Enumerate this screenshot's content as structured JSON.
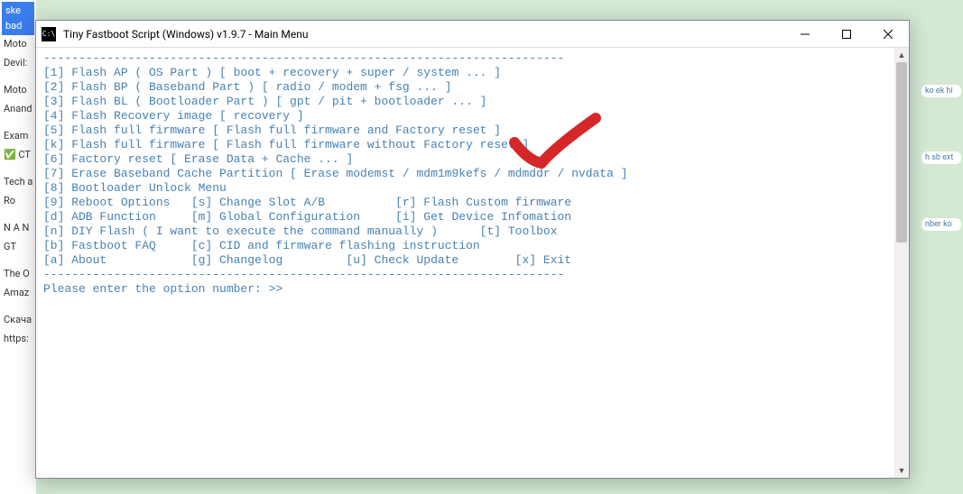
{
  "bg": {
    "blue_banner": "ske bad",
    "left_items": [
      "Moto",
      "Devil:",
      "",
      "Moto",
      "Anand",
      "",
      "Exam",
      "✅ CT",
      "",
      "Tech a",
      "Ro",
      "",
      "N A N",
      "GT",
      "",
      "The O",
      "Amaz",
      "",
      "Скача",
      "https:"
    ],
    "right_items": [
      "ko ek hi",
      "h sb ext",
      "nber ko"
    ]
  },
  "window": {
    "title": "Tiny Fastboot Script (Windows) v1.9.7 - Main Menu",
    "icon_text": "C:\\"
  },
  "console": {
    "lines": [
      "--------------------------------------------------------------------------",
      "[1] Flash AP ( OS Part ) [ boot + recovery + super / system ... ]",
      "[2] Flash BP ( Baseband Part ) [ radio / modem + fsg ... ]",
      "[3] Flash BL ( Bootloader Part ) [ gpt / pit + bootloader ... ]",
      "[4] Flash Recovery image [ recovery ]",
      "[5] Flash full firmware [ Flash full firmware and Factory reset ]",
      "[k] Flash full firmware [ Flash full firmware without Factory reset ]",
      "",
      "[6] Factory reset [ Erase Data + Cache ... ]",
      "[7] Erase Baseband Cache Partition [ Erase modemst / mdm1m9kefs / mdmddr / nvdata ]",
      "",
      "[8] Bootloader Unlock Menu",
      "",
      "[9] Reboot Options   [s] Change Slot A/B          [r] Flash Custom firmware",
      "",
      "[d] ADB Function     [m] Global Configuration     [i] Get Device Infomation",
      "",
      "[n] DIY Flash ( I want to execute the command manually )      [t] Toolbox",
      "",
      "[b] Fastboot FAQ     [c] CID and firmware flashing instruction",
      "",
      "[a] About            [g] Changelog         [u] Check Update        [x] Exit",
      "",
      "--------------------------------------------------------------------------",
      "",
      "",
      "Please enter the option number: >>"
    ]
  },
  "annotation": {
    "checkmark_color": "#d62728"
  }
}
